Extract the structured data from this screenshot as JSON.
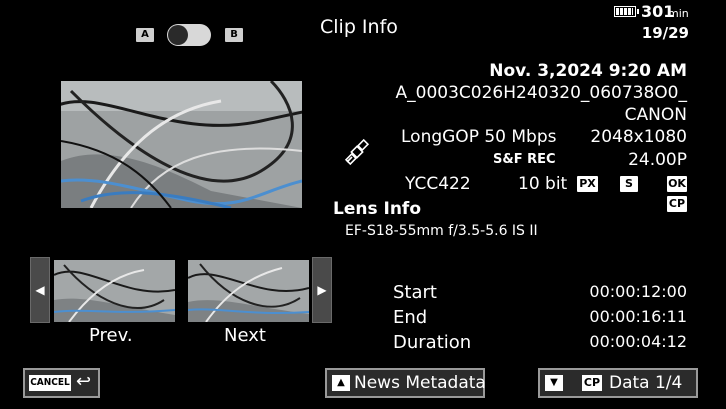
{
  "header": {
    "title": "Clip Info",
    "slot_a": "A",
    "slot_b": "B",
    "battery_time": "301",
    "battery_unit": "min",
    "clip_counter": "19/29"
  },
  "clip": {
    "date_time": "Nov. 3,2024  9:20 AM",
    "filename_line1": "A_0003C026H240320_060738O0_",
    "filename_line2": "CANON",
    "codec": "LongGOP 50 Mbps",
    "resolution": "2048x1080",
    "sf_rec": "S&F REC",
    "frame_rate": "24.00P",
    "color_sampling": "YCC422",
    "bit_depth": "10 bit",
    "tag_px": "PX",
    "tag_s": "S",
    "tag_ok": "OK",
    "tag_cp": "CP"
  },
  "lens": {
    "heading": "Lens Info",
    "model": "EF-S18-55mm f/3.5-5.6 IS II"
  },
  "navigation": {
    "prev_label": "Prev.",
    "next_label": "Next",
    "left_arrow": "◀",
    "right_arrow": "▶"
  },
  "timecode": {
    "start_label": "Start",
    "start_value": "00:00:12:00",
    "end_label": "End",
    "end_value": "00:00:16:11",
    "duration_label": "Duration",
    "duration_value": "00:00:04:12"
  },
  "footer": {
    "cancel_label": "CANCEL",
    "cancel_icon": "↩",
    "news_icon": "▲",
    "news_label": "News Metadata",
    "data_icon": "▼",
    "data_cp": "CP",
    "data_label": "Data 1/4"
  }
}
